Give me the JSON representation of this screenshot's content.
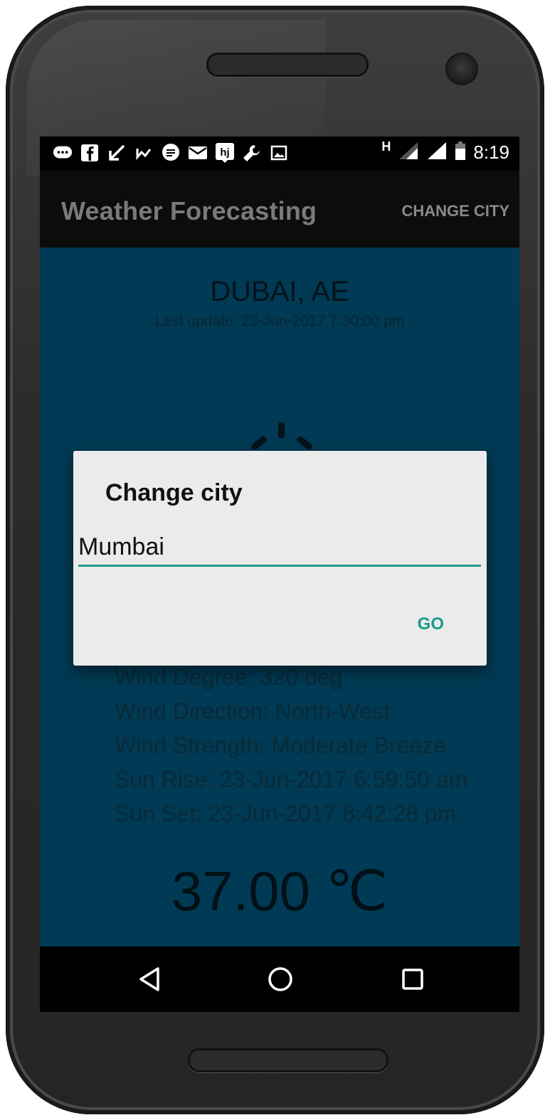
{
  "status_bar": {
    "network": "H",
    "time": "8:19",
    "icons": [
      "messages-icon",
      "facebook-icon",
      "arrow-icon",
      "signal-stat-icon",
      "chat-icon",
      "mail-icon",
      "hj-icon",
      "wrench-icon",
      "image-icon"
    ]
  },
  "action_bar": {
    "title": "Weather Forecasting",
    "menu_label": "CHANGE CITY"
  },
  "weather": {
    "city": "DUBAI, AE",
    "last_update": "Last update: 23-Jun-2017 7:30:00 pm",
    "details": [
      "Wind Degree: 320 deg",
      "Wind Direction: North-West",
      "Wind Strength: Moderate Breeze",
      "Sun Rise: 23-Jun-2017 6:59:50 am",
      "Sun Set: 23-Jun-2017 8:42:28 pm"
    ],
    "temperature": "37.00 ℃"
  },
  "dialog": {
    "title": "Change city",
    "input_value": "Mumbai",
    "go_label": "GO"
  },
  "colors": {
    "content_background": "#013a54",
    "accent": "#1b9a8c",
    "dialog_background": "#ebebeb"
  }
}
